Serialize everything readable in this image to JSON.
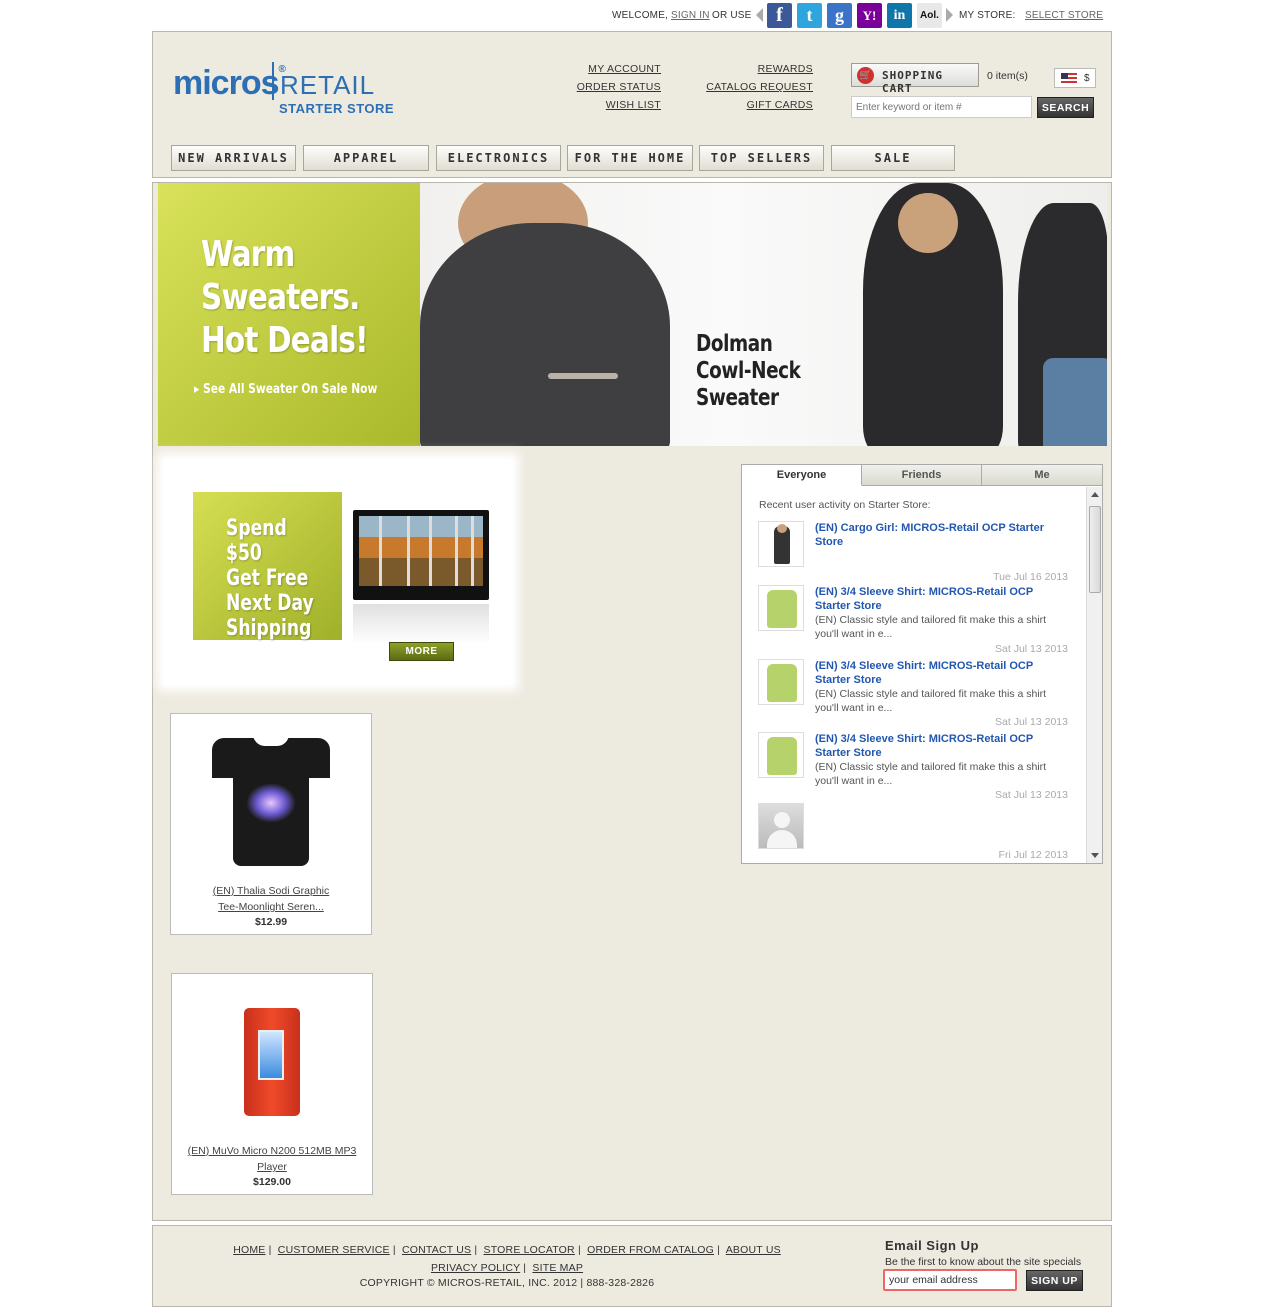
{
  "topbar": {
    "welcome": "WELCOME,",
    "sign_in": "SIGN IN",
    "or_use": "OR USE",
    "social": [
      {
        "icon": "facebook-icon",
        "glyph": "f",
        "color": "#3b5998"
      },
      {
        "icon": "twitter-icon",
        "glyph": "t",
        "color": "#2fa5dd"
      },
      {
        "icon": "google-icon",
        "glyph": "g",
        "color": "#3b73c8"
      },
      {
        "icon": "yahoo-icon",
        "glyph": "Y!",
        "color": "#7b0099"
      },
      {
        "icon": "linkedin-icon",
        "glyph": "in",
        "color": "#0e76a8"
      },
      {
        "icon": "aol-icon",
        "glyph": "Aol.",
        "color": "#e8e8e8"
      }
    ],
    "my_store": "MY STORE:",
    "select_store": "SELECT STORE"
  },
  "header": {
    "logo_micros": "micros",
    "logo_reg": "®",
    "logo_retail": "RETAIL",
    "logo_starter": "STARTER STORE",
    "links_col1": [
      "MY ACCOUNT",
      "ORDER STATUS",
      "WISH LIST"
    ],
    "links_col2": [
      "REWARDS",
      "CATALOG REQUEST",
      "GIFT CARDS"
    ],
    "cart_label": "SHOPPING CART",
    "cart_items": "0 item(s)",
    "currency": "$",
    "search_placeholder": "Enter keyword or item #",
    "search_button": "SEARCH"
  },
  "nav": [
    "NEW ARRIVALS",
    "APPAREL",
    "ELECTRONICS",
    "FOR THE HOME",
    "TOP SELLERS",
    "SALE"
  ],
  "hero": {
    "headline_1": "Warm",
    "headline_2": "Sweaters.",
    "headline_3": "Hot Deals!",
    "cta": "▸ See All Sweater On Sale Now",
    "product_1": "Dolman",
    "product_2": "Cowl-Neck",
    "product_3": "Sweater"
  },
  "promo": {
    "line_1": "Spend $50",
    "line_2": "Get Free",
    "line_3": "Next Day",
    "line_4": "Shipping",
    "more": "MORE"
  },
  "products": [
    {
      "name_1": "(EN) Thalia Sodi Graphic",
      "name_2": "Tee-Moonlight Seren...",
      "price": "$12.99"
    },
    {
      "name_1": "(EN) MuVo Micro N200 512MB MP3",
      "name_2": "Player",
      "price": "$129.00"
    }
  ],
  "activity": {
    "tabs": [
      "Everyone",
      "Friends",
      "Me"
    ],
    "intro": "Recent user activity on Starter Store:",
    "items": [
      {
        "title": "(EN) Cargo Girl: MICROS-Retail OCP Starter Store",
        "desc": "",
        "date": "Tue Jul 16 2013"
      },
      {
        "title": "(EN) 3/4 Sleeve Shirt: MICROS-Retail OCP Starter Store",
        "desc": "(EN) Classic style and tailored fit make this a shirt you'll want in e...",
        "date": "Sat Jul 13 2013"
      },
      {
        "title": "(EN) 3/4 Sleeve Shirt: MICROS-Retail OCP Starter Store",
        "desc": "(EN) Classic style and tailored fit make this a shirt you'll want in e...",
        "date": "Sat Jul 13 2013"
      },
      {
        "title": "(EN) 3/4 Sleeve Shirt: MICROS-Retail OCP Starter Store",
        "desc": "(EN) Classic style and tailored fit make this a shirt you'll want in e...",
        "date": "Sat Jul 13 2013"
      },
      {
        "title": "",
        "desc": "",
        "date": "Fri Jul 12 2013"
      }
    ]
  },
  "footer": {
    "links": [
      "HOME",
      "CUSTOMER SERVICE",
      "CONTACT US",
      "STORE LOCATOR",
      "ORDER FROM CATALOG",
      "ABOUT US",
      "PRIVACY POLICY",
      "SITE MAP"
    ],
    "copyright": "COPYRIGHT © MICROS-RETAIL, INC. 2012 | 888-328-2826",
    "email_title": "Email Sign Up",
    "email_text": "Be the first to know about the site specials",
    "email_placeholder": "your email address",
    "email_button": "SIGN UP"
  }
}
